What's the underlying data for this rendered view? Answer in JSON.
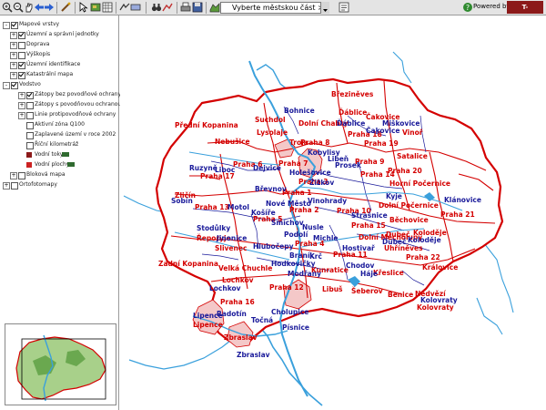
{
  "toolbar": {
    "district_select_value": "Vyberte městskou část >>>",
    "powered_by": "Powered by",
    "brand_logo": "T-MAPSERVER"
  },
  "sidebar": {
    "tree": [
      {
        "label": "Mapové vrstvy",
        "checked": true,
        "expander": "-"
      },
      {
        "label": "Územní a správní jednotky",
        "checked": true,
        "expander": "+"
      },
      {
        "label": "Doprava",
        "checked": false,
        "expander": "+"
      },
      {
        "label": "Výškopis",
        "checked": false,
        "expander": "+"
      },
      {
        "label": "Územní identifikace",
        "checked": true,
        "expander": "+"
      },
      {
        "label": "Katastrální mapa",
        "checked": true,
        "expander": "+"
      },
      {
        "label": "Vodstvo",
        "checked": true,
        "expander": "-"
      },
      {
        "label": "Zátopy bez povodňové ochrany",
        "checked": true,
        "expander": "+"
      },
      {
        "label": "Zátopy s povodňovou ochranou",
        "checked": false,
        "expander": "+"
      },
      {
        "label": "Linie protipovodňové ochrany",
        "checked": false,
        "expander": "+"
      },
      {
        "label": "Aktivní zóna Q100",
        "checked": false
      },
      {
        "label": "Zaplavené území v roce 2002",
        "checked": false
      },
      {
        "label": "Říční kilometráž",
        "checked": false
      },
      {
        "label": "Vodní toky",
        "checked": true
      },
      {
        "label": "Vodní plochy",
        "checked": true
      },
      {
        "label": "Bloková mapa",
        "checked": false,
        "expander": "+"
      },
      {
        "label": "Ortofotomapy",
        "checked": false,
        "expander": "+"
      }
    ]
  },
  "map": {
    "colors": {
      "boundary": "#d40000",
      "river": "#3aa0dc",
      "district_line": "#1a1a9a",
      "flood": "#f4c8c8"
    },
    "labels_red": [
      "Březiněves",
      "Ďáblice",
      "Čakovice",
      "Přední Kopanina",
      "Suchdol",
      "Dolní Chabry",
      "Praha 18",
      "Vinoř",
      "Lysolaje",
      "Praha 8",
      "Praha 19",
      "Nebušice",
      "Troja",
      "Praha 9",
      "Satalice",
      "Praha 7",
      "Praha 14",
      "Praha 20",
      "Praha 6",
      "Praha 17",
      "Praha 3",
      "Horní Počernice",
      "Zličín",
      "Praha 1",
      "Dolní Počernice",
      "Praha 13",
      "Praha 2",
      "Praha 10",
      "Běchovice",
      "Praha 5",
      "Praha 15",
      "Dubeč",
      "Praha 21",
      "Řeporyje",
      "Praha 4",
      "Dolní Měcholupy",
      "Koloděje",
      "Slivenec",
      "Praha 11",
      "Uhříněves",
      "Velká Chuchle",
      "Praha 22",
      "Zadní Kopanina",
      "Lochkov",
      "Kunratice",
      "Křeslice",
      "Královice",
      "Praha 12",
      "Libuš",
      "Šeberov",
      "Benice",
      "Nedvězí",
      "Praha 16",
      "Kolovraty",
      "Lipence",
      "Zbraslav"
    ],
    "labels_blue": [
      "Bohnice",
      "Ďáblice",
      "Miškovice",
      "Čakovice",
      "Kobylisy",
      "Prosek",
      "Libeň",
      "Ruzyně",
      "Liboc",
      "Dejvice",
      "Holešovice",
      "Žižkov",
      "Břevnov",
      "Kyje",
      "Klánovice",
      "Sobín",
      "Nové Město",
      "Motol",
      "Košíře",
      "Smíchov",
      "Vinohrady",
      "Hlubočepy",
      "Podolí",
      "Nusle",
      "Michle",
      "Strašnice",
      "Koloděje",
      "Stodůlky",
      "Jinonice",
      "Hostivař",
      "Dubeč",
      "Modřany",
      "Braník",
      "Krč",
      "Chodov",
      "Háje",
      "Hodkovičky",
      "Kolovraty",
      "Točná",
      "Cholupice",
      "Písnice",
      "Radotín",
      "Lochkov",
      "Zbraslav",
      "Lipence"
    ]
  }
}
